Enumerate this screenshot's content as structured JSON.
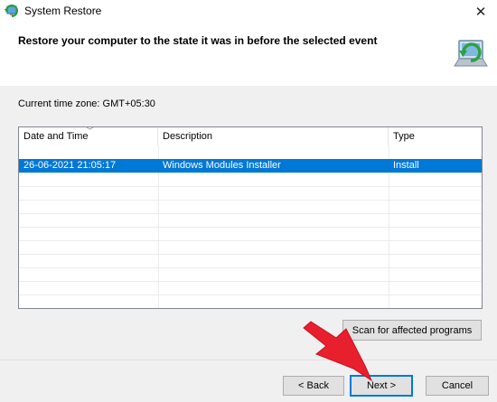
{
  "window": {
    "title": "System Restore",
    "close_glyph": "✕"
  },
  "header": {
    "heading": "Restore your computer to the state it was in before the selected event"
  },
  "main": {
    "timezone": "Current time zone: GMT+05:30",
    "columns": [
      "Date and Time",
      "Description",
      "Type"
    ],
    "rows": [
      {
        "date": "26-06-2021 21:05:17",
        "description": "Windows Modules Installer",
        "type": "Install"
      }
    ],
    "scan_button": "Scan for affected programs"
  },
  "footer": {
    "back_button": "< Back",
    "next_button": "Next >",
    "cancel_button": "Cancel"
  },
  "colors": {
    "selection": "#0078d7",
    "annotation_arrow": "#e8202e"
  },
  "icons": [
    "system-restore-icon",
    "close-icon",
    "restore-monitor-icon",
    "sort-caret-icon",
    "annotation-arrow-icon"
  ]
}
